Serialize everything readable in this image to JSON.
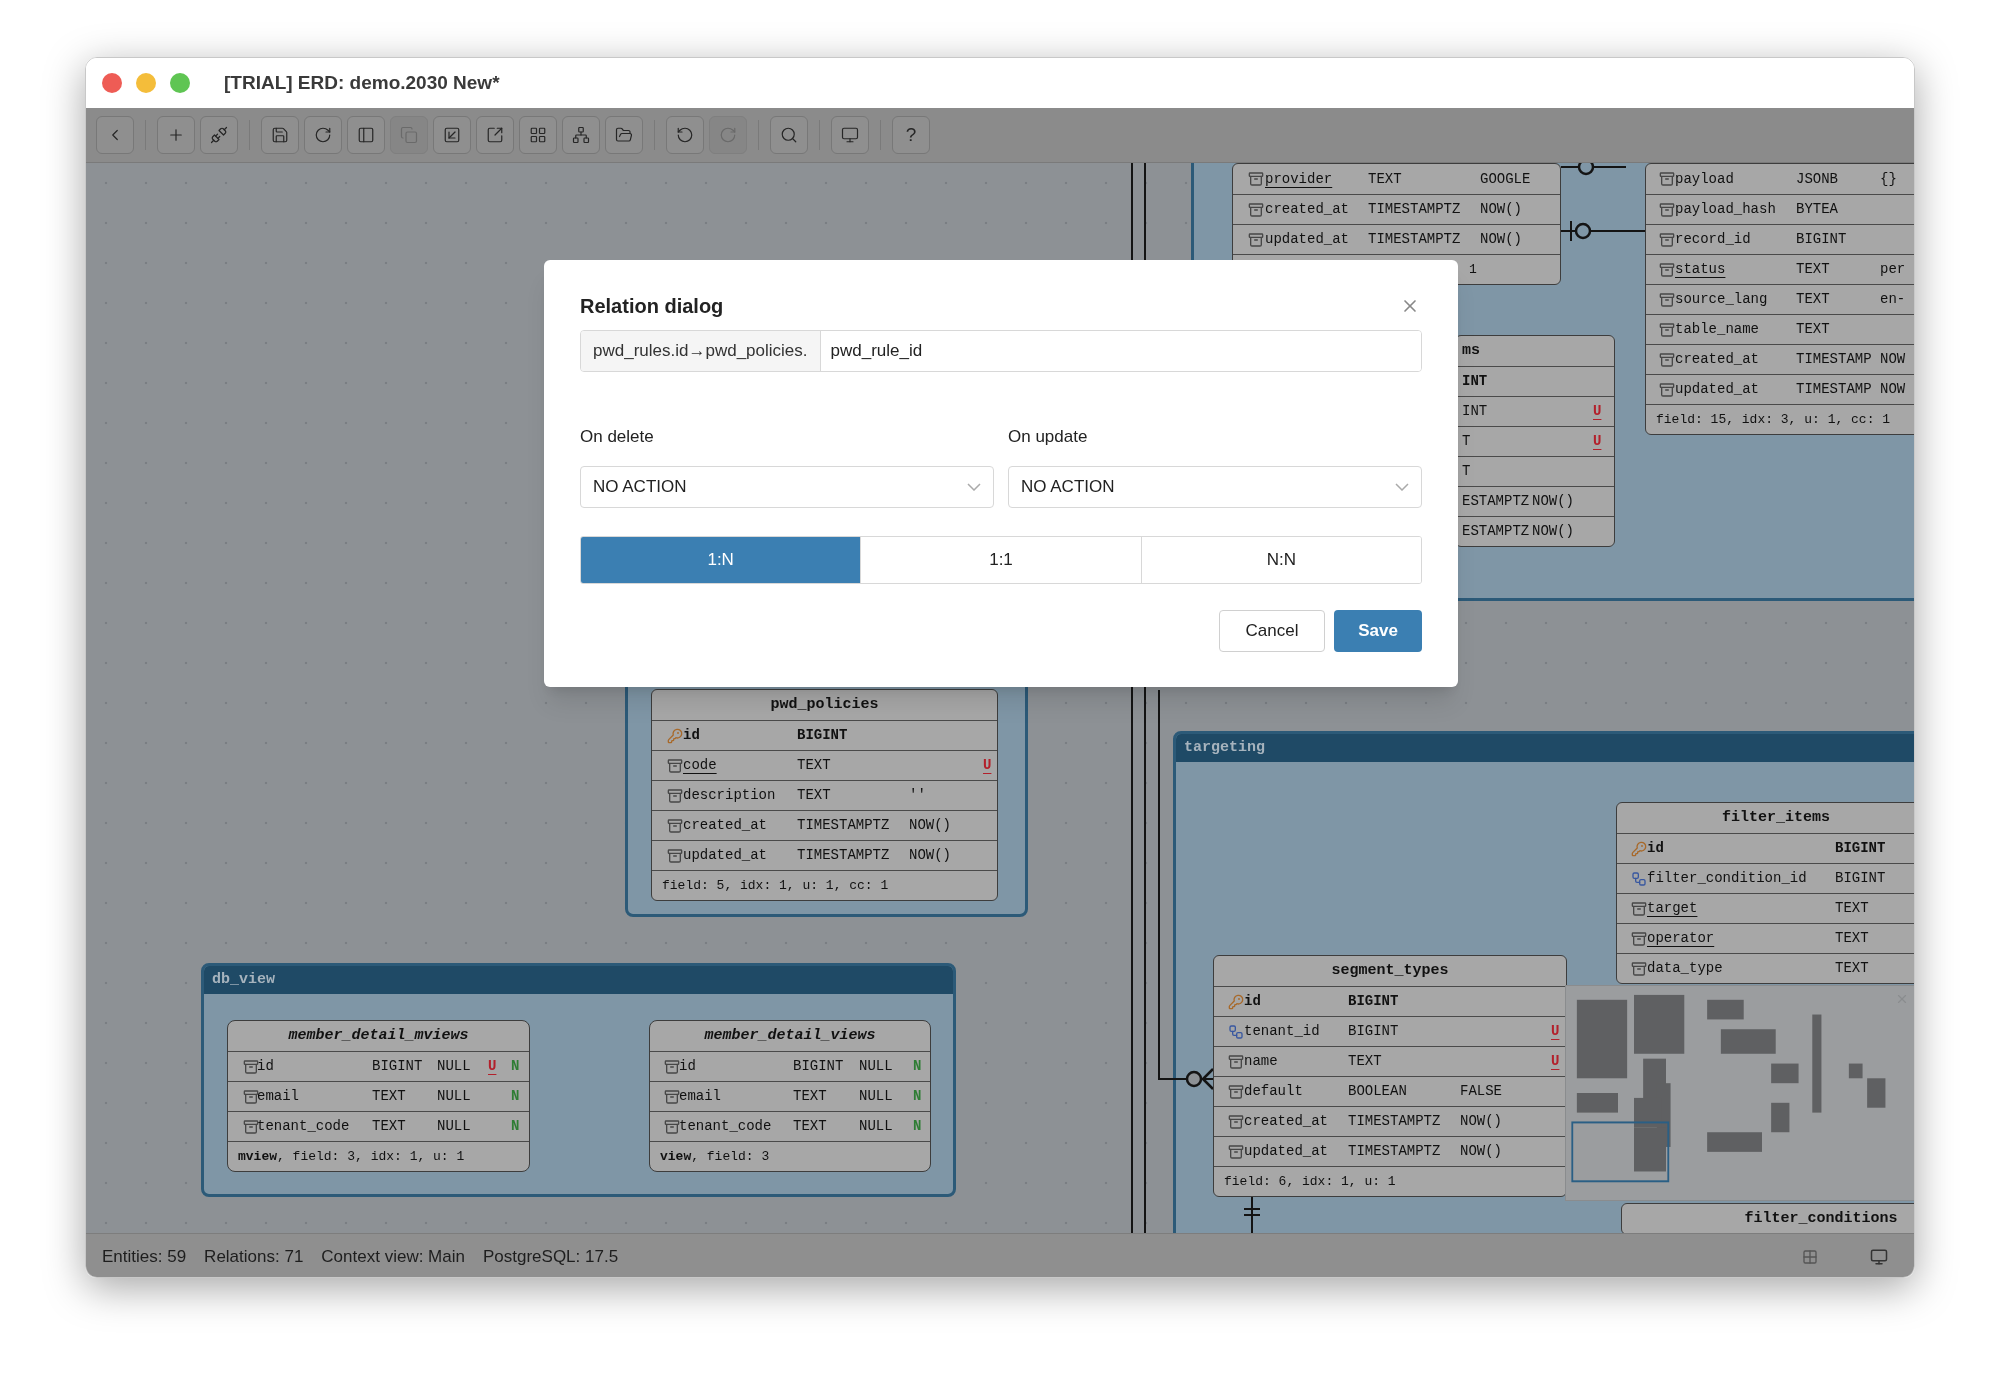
{
  "window": {
    "title": "[TRIAL] ERD: demo.2030 New*"
  },
  "toolbar": {
    "groups": [
      [
        {
          "disabled": false
        }
      ],
      [
        {
          "disabled": false
        },
        {
          "disabled": false
        }
      ],
      [
        {
          "disabled": false
        },
        {
          "disabled": false
        },
        {
          "disabled": false
        },
        {
          "disabled": true
        },
        {
          "disabled": false
        },
        {
          "disabled": false
        },
        {
          "disabled": false
        },
        {
          "disabled": false
        },
        {
          "disabled": false
        }
      ],
      [
        {
          "disabled": false
        },
        {
          "disabled": true
        }
      ],
      [
        {
          "disabled": false
        }
      ],
      [
        {
          "disabled": false
        }
      ],
      [
        {
          "label": "?",
          "disabled": false
        }
      ]
    ]
  },
  "canvas": {
    "groups": [
      {
        "kind": "plain"
      },
      {
        "kind": "plain"
      },
      {
        "kind": "titled",
        "title": "targeting"
      },
      {
        "kind": "titled",
        "title": "db_view"
      }
    ],
    "tables": [
      {
        "kind": "table",
        "fields": [
          {
            "kind": "col",
            "name": "provider",
            "underlined": true,
            "type": "TEXT",
            "default": "GOOGLE"
          },
          {
            "kind": "col",
            "name": "created_at",
            "underlined": false,
            "type": "TIMESTAMPTZ",
            "default": "NOW()"
          },
          {
            "kind": "col",
            "name": "updated_at",
            "underlined": false,
            "type": "TIMESTAMPTZ",
            "default": "NOW()"
          }
        ],
        "footer": "1"
      },
      {
        "kind": "table",
        "title": "ms",
        "fields": [
          {
            "kind": "pk",
            "type": "INT"
          },
          {
            "kind": "col",
            "type": "INT",
            "unique": "U"
          },
          {
            "kind": "col",
            "type": "T",
            "unique": "U"
          },
          {
            "kind": "col",
            "type": "T"
          },
          {
            "kind": "col",
            "type": "ESTAMPTZ",
            "default": "NOW()"
          },
          {
            "kind": "col",
            "type": "ESTAMPTZ",
            "default": "NOW()"
          }
        ]
      },
      {
        "kind": "table",
        "fields": [
          {
            "kind": "col",
            "name": "payload",
            "underlined": false,
            "type": "JSONB",
            "default": "{}"
          },
          {
            "kind": "col",
            "name": "payload_hash",
            "underlined": false,
            "type": "BYTEA"
          },
          {
            "kind": "col",
            "name": "record_id",
            "underlined": false,
            "type": "BIGINT"
          },
          {
            "kind": "col",
            "name": "status",
            "underlined": true,
            "type": "TEXT",
            "default": "per"
          },
          {
            "kind": "col",
            "name": "source_lang",
            "underlined": false,
            "type": "TEXT",
            "default": "en-"
          },
          {
            "kind": "col",
            "name": "table_name",
            "underlined": false,
            "type": "TEXT"
          },
          {
            "kind": "col",
            "name": "created_at",
            "underlined": false,
            "type": "TIMESTAMP",
            "default": "NOW"
          },
          {
            "kind": "col",
            "name": "updated_at",
            "underlined": false,
            "type": "TIMESTAMP",
            "default": "NOW"
          }
        ],
        "footer": "field: 15, idx: 3, u: 1, cc: 1"
      },
      {
        "kind": "table",
        "title": "pwd_policies",
        "fields": [
          {
            "kind": "pk",
            "name": "id",
            "underlined": false,
            "type": "BIGINT"
          },
          {
            "kind": "col",
            "name": "code",
            "underlined": true,
            "type": "TEXT",
            "unique": "U"
          },
          {
            "kind": "col",
            "name": "description",
            "underlined": false,
            "type": "TEXT",
            "default": "''"
          },
          {
            "kind": "col",
            "name": "created_at",
            "underlined": false,
            "type": "TIMESTAMPTZ",
            "default": "NOW()"
          },
          {
            "kind": "col",
            "name": "updated_at",
            "underlined": false,
            "type": "TIMESTAMPTZ",
            "default": "NOW()"
          }
        ],
        "footer": "field: 5, idx: 1, u: 1, cc: 1"
      },
      {
        "kind": "view",
        "title": "member_detail_mviews",
        "fields": [
          {
            "kind": "col",
            "name": "id",
            "underlined": false,
            "type": "BIGINT",
            "null": "NULL",
            "unique": "U",
            "nullable": "N"
          },
          {
            "kind": "col",
            "name": "email",
            "underlined": false,
            "type": "TEXT",
            "null": "NULL",
            "nullable": "N"
          },
          {
            "kind": "col",
            "name": "tenant_code",
            "underlined": false,
            "type": "TEXT",
            "null": "NULL",
            "nullable": "N"
          }
        ],
        "footer": "**mview**, field: 3, idx: 1, u: 1"
      },
      {
        "kind": "view",
        "title": "member_detail_views",
        "fields": [
          {
            "kind": "col",
            "name": "id",
            "underlined": false,
            "type": "BIGINT",
            "null": "NULL",
            "nullable": "N"
          },
          {
            "kind": "col",
            "name": "email",
            "underlined": false,
            "type": "TEXT",
            "null": "NULL",
            "nullable": "N"
          },
          {
            "kind": "col",
            "name": "tenant_code",
            "underlined": false,
            "type": "TEXT",
            "null": "NULL",
            "nullable": "N"
          }
        ],
        "footer": "**view**, field: 3"
      },
      {
        "kind": "table",
        "title": "segment_types",
        "fields": [
          {
            "kind": "pk",
            "name": "id",
            "underlined": false,
            "type": "BIGINT"
          },
          {
            "kind": "fk",
            "name": "tenant_id",
            "underlined": false,
            "type": "BIGINT",
            "unique": "U"
          },
          {
            "kind": "col",
            "name": "name",
            "underlined": false,
            "type": "TEXT",
            "unique": "U"
          },
          {
            "kind": "col",
            "name": "default",
            "underlined": false,
            "type": "BOOLEAN",
            "default": "FALSE"
          },
          {
            "kind": "col",
            "name": "created_at",
            "underlined": false,
            "type": "TIMESTAMPTZ",
            "default": "NOW()"
          },
          {
            "kind": "col",
            "name": "updated_at",
            "underlined": false,
            "type": "TIMESTAMPTZ",
            "default": "NOW()"
          }
        ],
        "footer": "field: 6, idx: 1, u: 1"
      },
      {
        "kind": "table",
        "title": "filter_items",
        "fields": [
          {
            "kind": "pk",
            "name": "id",
            "underlined": false,
            "type": "BIGINT"
          },
          {
            "kind": "fk",
            "name": "filter_condition_id",
            "underlined": false,
            "type": "BIGINT"
          },
          {
            "kind": "col",
            "name": "target",
            "underlined": true,
            "type": "TEXT"
          },
          {
            "kind": "col",
            "name": "operator",
            "underlined": true,
            "type": "TEXT"
          },
          {
            "kind": "col",
            "name": "data_type",
            "underlined": false,
            "type": "TEXT"
          }
        ]
      },
      {
        "kind": "table",
        "title": "filter_conditions"
      }
    ]
  },
  "dialog": {
    "title": "Relation dialog",
    "prefix": "pwd_rules.id→pwd_policies.",
    "value": "pwd_rule_id",
    "on_delete": {
      "label": "On delete",
      "value": "NO ACTION"
    },
    "on_update": {
      "label": "On update",
      "value": "NO ACTION"
    },
    "cardinality": [
      {
        "label": "1:N",
        "selected": true
      },
      {
        "label": "1:1",
        "selected": false
      },
      {
        "label": "N:N",
        "selected": false
      }
    ],
    "buttons": [
      {
        "label": "Cancel",
        "kind": "secondary"
      },
      {
        "label": "Save",
        "kind": "primary"
      }
    ]
  },
  "status_bar": {
    "items": [
      "Entities: 59",
      "Relations: 71",
      "Context view: Main",
      "PostgreSQL: 17.5"
    ]
  }
}
